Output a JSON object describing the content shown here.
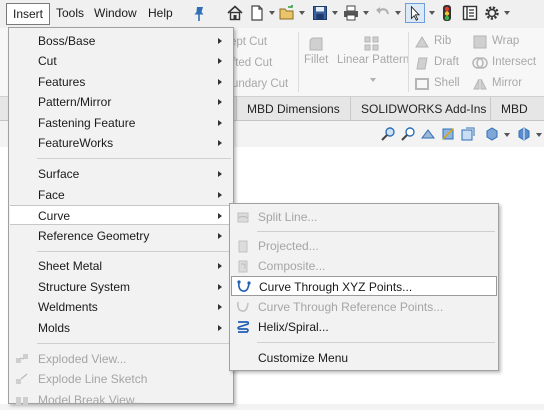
{
  "menubar": {
    "items": [
      {
        "label": "Insert",
        "active": true
      },
      {
        "label": "Tools"
      },
      {
        "label": "Window"
      },
      {
        "label": "Help"
      }
    ]
  },
  "ribbon": {
    "partial_labels": [
      "ept Cut",
      "fted Cut",
      "undary Cut"
    ],
    "fillet": "Fillet",
    "linear_pattern": "Linear Pattern",
    "rib": "Rib",
    "draft": "Draft",
    "shell": "Shell",
    "wrap": "Wrap",
    "intersect": "Intersect",
    "mirror": "Mirror"
  },
  "tabs": [
    {
      "label": "MBD Dimensions"
    },
    {
      "label": "SOLIDWORKS Add-Ins"
    },
    {
      "label": "MBD"
    }
  ],
  "insert_menu": {
    "items": [
      {
        "label": "Boss/Base",
        "submenu": true
      },
      {
        "label": "Cut",
        "submenu": true
      },
      {
        "label": "Features",
        "submenu": true
      },
      {
        "label": "Pattern/Mirror",
        "submenu": true
      },
      {
        "label": "Fastening Feature",
        "submenu": true
      },
      {
        "label": "FeatureWorks",
        "submenu": true
      },
      {
        "label": "Surface",
        "submenu": true
      },
      {
        "label": "Face",
        "submenu": true
      },
      {
        "label": "Curve",
        "submenu": true,
        "highlighted": true
      },
      {
        "label": "Reference Geometry",
        "submenu": true
      },
      {
        "label": "Sheet Metal",
        "submenu": true
      },
      {
        "label": "Structure System",
        "submenu": true
      },
      {
        "label": "Weldments",
        "submenu": true
      },
      {
        "label": "Molds",
        "submenu": true
      },
      {
        "label": "Exploded View...",
        "disabled": true
      },
      {
        "label": "Explode Line Sketch",
        "disabled": true
      },
      {
        "label": "Model Break View...",
        "disabled": true
      }
    ]
  },
  "curve_menu": {
    "items": [
      {
        "label": "Split Line...",
        "disabled": true
      },
      {
        "label": "Projected...",
        "disabled": true
      },
      {
        "label": "Composite...",
        "disabled": true
      },
      {
        "label": "Curve Through XYZ Points...",
        "highlighted": true
      },
      {
        "label": "Curve Through Reference Points...",
        "disabled": true
      },
      {
        "label": "Helix/Spiral..."
      },
      {
        "label": "Customize Menu"
      }
    ]
  },
  "colors": {
    "menu_bg": "#f2f2f2",
    "highlight_bg": "#ffffff",
    "disabled_text": "#a5a5a5",
    "accent_blue": "#1f5fb4"
  }
}
